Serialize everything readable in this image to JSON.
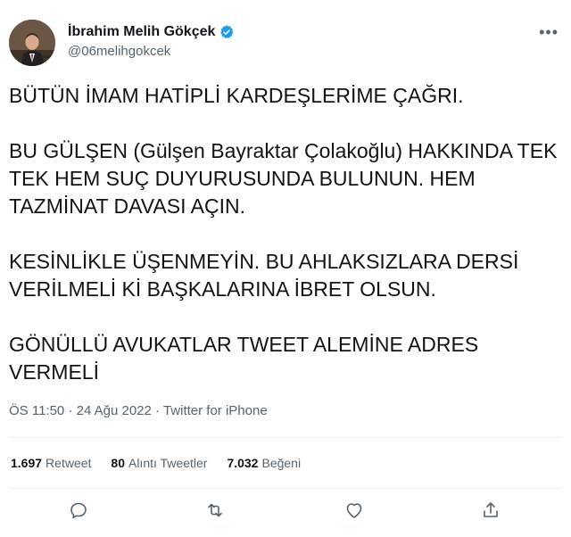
{
  "author": {
    "name": "İbrahim Melih Gökçek",
    "handle": "@06melihgokcek"
  },
  "icons": {
    "verified": "verified-badge-icon",
    "more": "more-options-icon",
    "reply": "reply-icon",
    "retweet": "retweet-icon",
    "like": "like-icon",
    "share": "share-icon"
  },
  "tweet": {
    "paragraphs": [
      "BÜTÜN İMAM HATİPLİ KARDEŞLERİME ÇAĞRI.",
      "BU GÜLŞEN (Gülşen Bayraktar Çolakoğlu) HAKKINDA TEK TEK HEM SUÇ DUYURUSUNDA BULUNUN. HEM TAZMİNAT DAVASI AÇIN.",
      "KESİNLİKLE ÜŞENMEYİN. BU AHLAKSIZLARA DERSİ VERİLMELİ Kİ BAŞKALARINA İBRET OLSUN.",
      "GÖNÜLLÜ AVUKATLAR TWEET ALEMİNE ADRES VERMELİ"
    ],
    "time": "ÖS 11:50",
    "separator1": " · ",
    "date": "24 Ağu 2022",
    "separator2": " · ",
    "source": "Twitter for iPhone"
  },
  "stats": {
    "retweets_count": "1.697",
    "retweets_label": "Retweet",
    "quotes_count": "80",
    "quotes_label": "Alıntı Tweetler",
    "likes_count": "7.032",
    "likes_label": "Beğeni"
  },
  "colors": {
    "verified": "#1d9bf0",
    "text": "#0f1419",
    "secondary": "#536471",
    "divider": "#eff3f4"
  }
}
